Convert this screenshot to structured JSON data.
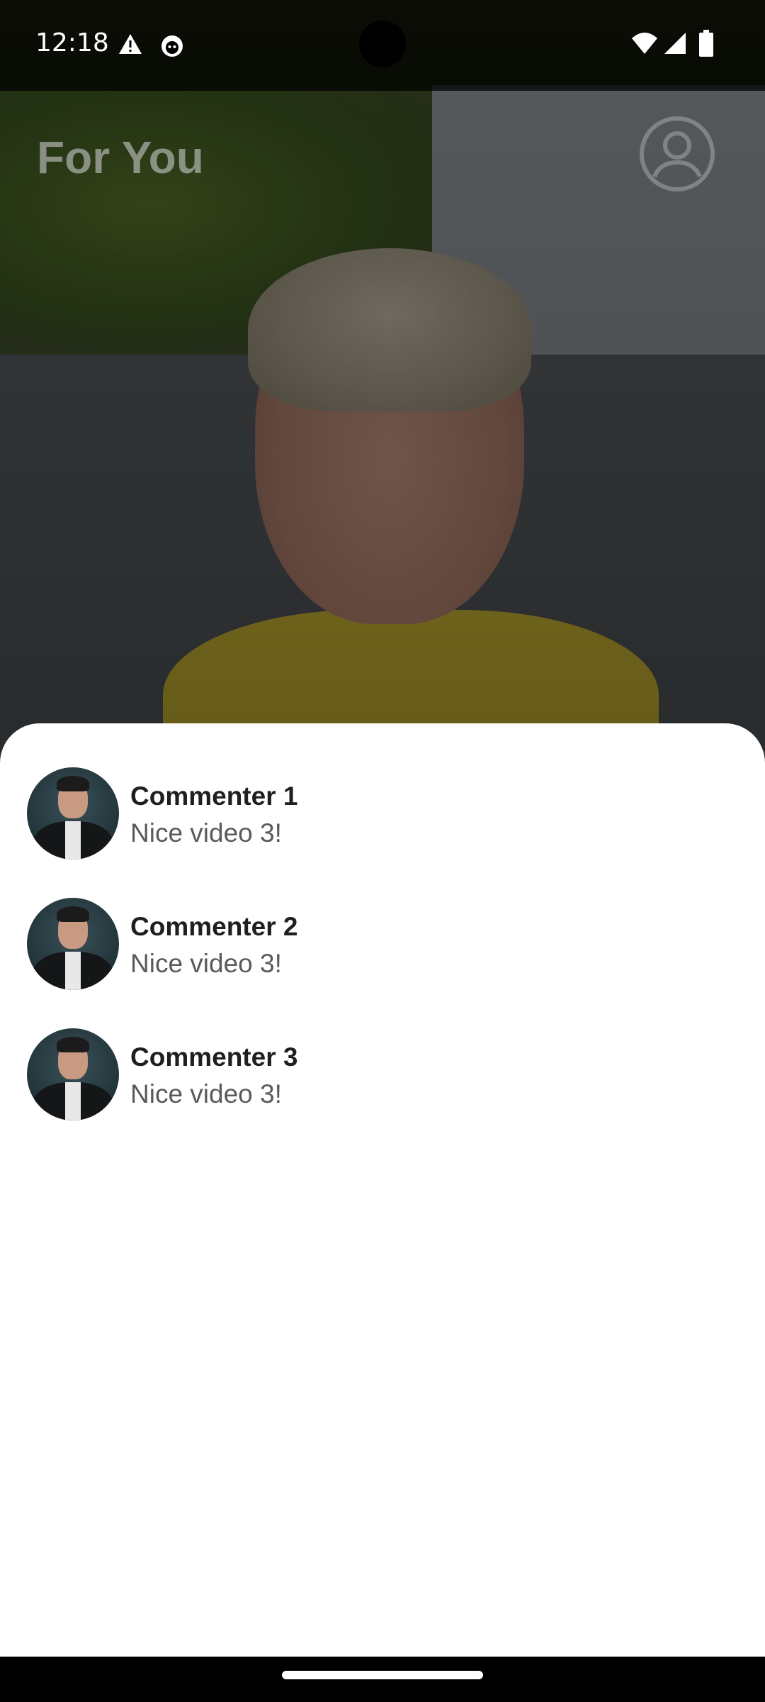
{
  "status_bar": {
    "time": "12:18",
    "icons": [
      "warning-icon",
      "app-notification-icon",
      "wifi-icon",
      "signal-icon",
      "battery-icon"
    ]
  },
  "header": {
    "title": "For You",
    "profile_icon": "account-circle-icon"
  },
  "video": {
    "description_icon": "video-frame"
  },
  "comments": [
    {
      "author": "Commenter 1",
      "text": "Nice video 3!"
    },
    {
      "author": "Commenter 2",
      "text": "Nice video 3!"
    },
    {
      "author": "Commenter 3",
      "text": "Nice video 3!"
    }
  ],
  "colors": {
    "sheet_background": "#ffffff",
    "author_text": "#1f1f1f",
    "comment_text": "#5a5a5a",
    "title_text": "#bebebe"
  }
}
